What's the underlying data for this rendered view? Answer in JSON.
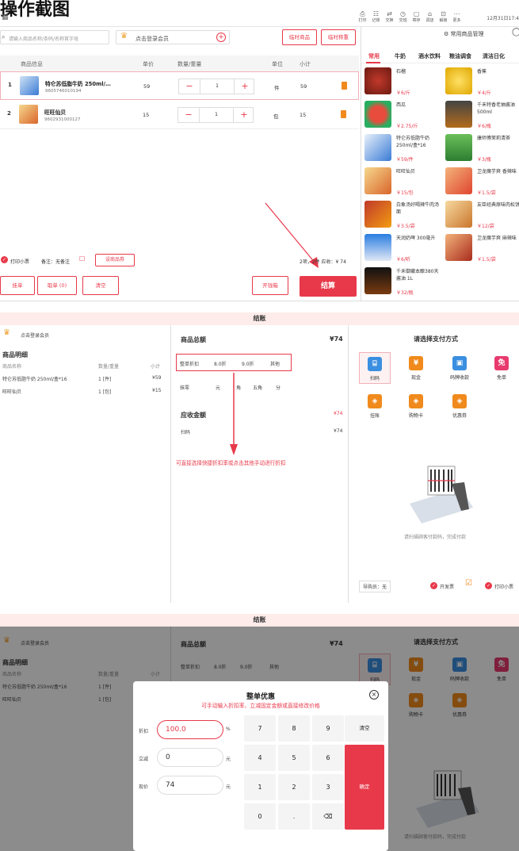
{
  "page_title": "操作截图",
  "cashier": {
    "topbar": {
      "menu_icon": "grid-icon",
      "buttons": [
        "打印",
        "记账",
        "交换",
        "交班",
        "寄存",
        "调店",
        "解锁",
        "更多"
      ],
      "datetime": "12月31日17:4"
    },
    "search_placeholder": "请输入商品名称/条码/名称首字母",
    "member_label": "点击登录会员",
    "btn_temp_goods": "临时商品",
    "btn_temp_weigh": "临时称重",
    "table_headers": [
      "商品信息",
      "单价",
      "数量/重量",
      "单位",
      "小计"
    ],
    "rows": [
      {
        "idx": "1",
        "name": "特仑苏低脂牛奶 250ml/…",
        "code": "9605746010194",
        "price": "59",
        "qty": "1",
        "unit": "件",
        "subtotal": "59"
      },
      {
        "idx": "2",
        "name": "旺旺仙贝",
        "code": "9602931000127",
        "price": "15",
        "qty": "1",
        "unit": "包",
        "subtotal": "15"
      }
    ],
    "print_receipt": "打印小票",
    "note": "备注：无备注",
    "change_goods": "设商品券",
    "summary": "2项，2件 应收：¥ 74",
    "btn_hold": "挂单",
    "btn_retrieve": "取单 (0)",
    "btn_clear": "清空",
    "btn_drawer": "开钱箱",
    "btn_checkout": "结算",
    "goods_manage": "常用商品管理",
    "tabs": [
      "常用",
      "牛奶",
      "酒水饮料",
      "粮油调食",
      "清洁日化"
    ],
    "goods": [
      {
        "name": "石榴",
        "price": "￥6/斤"
      },
      {
        "name": "香蕉",
        "price": "￥4/斤"
      },
      {
        "name": "西瓜",
        "price": "￥2.75/斤"
      },
      {
        "name": "千禾特香老抽酱油 500ml",
        "price": "￥6/瓶"
      },
      {
        "name": "特仑苏低脂牛奶 250ml/盒*16",
        "price": "￥59/件"
      },
      {
        "name": "康师傅茉莉清茶",
        "price": "￥3/瓶"
      },
      {
        "name": "旺旺仙贝",
        "price": "￥15/包"
      },
      {
        "name": "卫龙魔芋爽 香辣味",
        "price": "￥1.5/袋"
      },
      {
        "name": "白象汤好喝辣牛肉汤面",
        "price": "￥3.5/袋"
      },
      {
        "name": "友臣经典原味肉松饼",
        "price": "￥12/袋"
      },
      {
        "name": "天润奶啤 300毫升",
        "price": "￥6/听"
      },
      {
        "name": "卫龙魔芋爽 麻辣味",
        "price": "￥1.5/袋"
      },
      {
        "name": "千禾御藏本酿380天酱油 1L",
        "price": "￥32/瓶"
      }
    ]
  },
  "checkout": {
    "title": "结账",
    "member_label": "点击登录会员",
    "detail_title": "商品明细",
    "detail_headers": [
      "商品名称",
      "数量/重量",
      "小计"
    ],
    "detail_rows": [
      {
        "name": "特仑苏低脂牛奶 250ml/盒*16",
        "qty": "1 [件]",
        "subtotal": "¥59"
      },
      {
        "name": "旺旺仙贝",
        "qty": "1 [包]",
        "subtotal": "¥15"
      }
    ],
    "total_label": "商品总额",
    "total_value": "¥74",
    "discount_label": "整单折扣",
    "discount_options": [
      "8.0折",
      "9.0折",
      "其他"
    ],
    "rounding_label": "抹零",
    "rounding_options": [
      "元",
      "角",
      "五角",
      "分"
    ],
    "receivable_label": "应收金额",
    "receivable_value": "¥74",
    "scan_label": "扫码",
    "scan_value": "¥74",
    "annotation": "可直接选择快捷折扣率或点击其他手动进行折扣",
    "pay_title": "请选择支付方式",
    "pay_methods": [
      "扫码",
      "现金",
      "码牌收款",
      "免单",
      "挂账",
      "购物卡",
      "优惠券"
    ],
    "scan_hint": "请扫描顾客付款码，完成付款",
    "guide_label": "导购员：无",
    "invoice_label": "开发票",
    "print_label": "打印小票"
  },
  "modal": {
    "title": "整单优惠",
    "subtitle": "可手动输入折扣率、立减固定金额或直接修改价格",
    "discount_label": "折扣",
    "discount_value": "100.0",
    "discount_unit": "%",
    "reduce_label": "立减",
    "reduce_value": "0",
    "reduce_unit": "元",
    "price_label": "现价",
    "price_value": "74",
    "price_unit": "元",
    "keys": [
      "7",
      "8",
      "9",
      "4",
      "5",
      "6",
      "1",
      "2",
      "3",
      "0",
      "."
    ],
    "clear_key": "清空",
    "confirm_key": "确定"
  }
}
